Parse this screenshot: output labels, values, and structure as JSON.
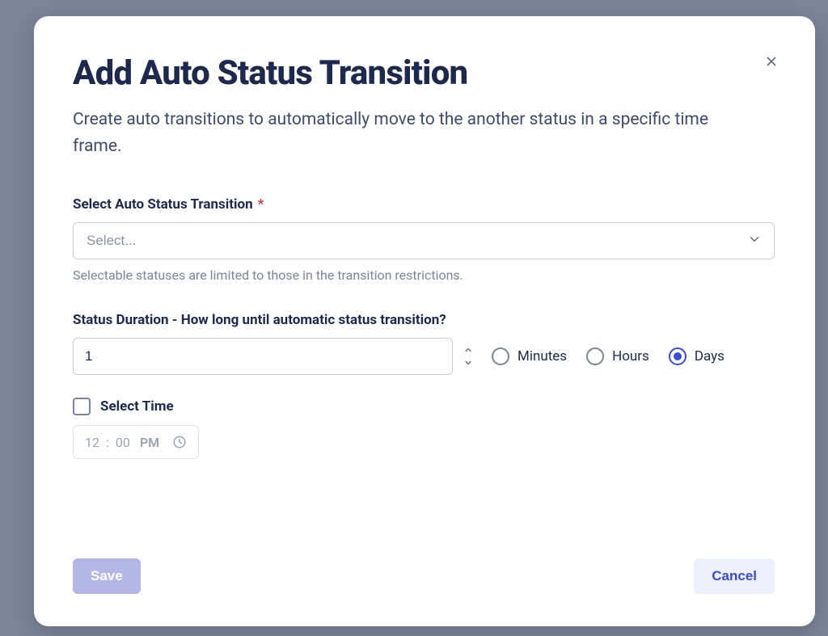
{
  "modal": {
    "title": "Add Auto Status Transition",
    "description": "Create auto transitions to automatically move to the another status in a specific time frame."
  },
  "fields": {
    "status_select": {
      "label": "Select Auto Status Transition",
      "required_marker": "*",
      "placeholder": "Select...",
      "helper": "Selectable statuses are limited to those in the transition restrictions."
    },
    "duration": {
      "label": "Status Duration - How long until automatic status transition?",
      "value": "1",
      "units": {
        "minutes": "Minutes",
        "hours": "Hours",
        "days": "Days",
        "selected": "days"
      }
    },
    "time": {
      "checkbox_label": "Select Time",
      "checked": false,
      "hour": "12",
      "separator": ":",
      "minute": "00",
      "meridiem": "PM"
    }
  },
  "buttons": {
    "save": "Save",
    "cancel": "Cancel"
  }
}
